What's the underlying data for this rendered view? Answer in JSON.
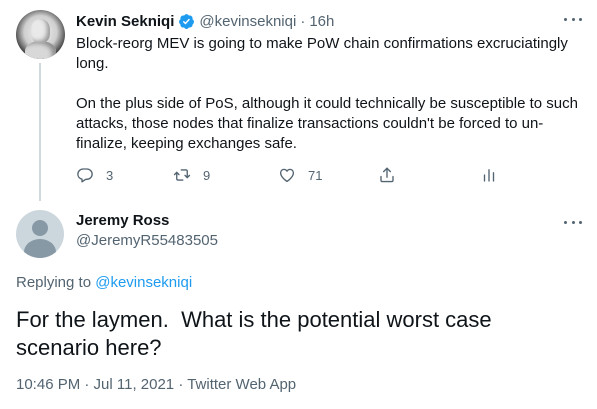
{
  "colors": {
    "text": "#0f1419",
    "secondary": "#536471",
    "link": "#1d9bf0",
    "divider": "#cfd9de"
  },
  "parent_tweet": {
    "author_name": "Kevin Sekniqi",
    "verified_icon": "verified-badge-icon",
    "handle": "@kevinsekniqi",
    "separator": "·",
    "time": "16h",
    "text_p1": "Block-reorg MEV is going to make PoW chain confirmations excruciatingly long.",
    "text_p2": "On the plus side of PoS, although it could technically be susceptible to such attacks, those nodes that finalize transactions couldn't be forced to un-finalize, keeping exchanges safe.",
    "actions": {
      "reply": {
        "icon": "reply-icon",
        "count": "3"
      },
      "retweet": {
        "icon": "retweet-icon",
        "count": "9"
      },
      "like": {
        "icon": "heart-icon",
        "count": "71"
      },
      "share": {
        "icon": "share-icon"
      },
      "analytics": {
        "icon": "analytics-icon"
      }
    }
  },
  "reply_tweet": {
    "author_name": "Jeremy Ross",
    "handle": "@JeremyR55483505",
    "replying_prefix": "Replying to ",
    "replying_to": "@kevinsekniqi",
    "text": "For the laymen.  What is the potential worst case scenario here?",
    "timestamp": "10:46 PM · Jul 11, 2021 · Twitter Web App"
  }
}
